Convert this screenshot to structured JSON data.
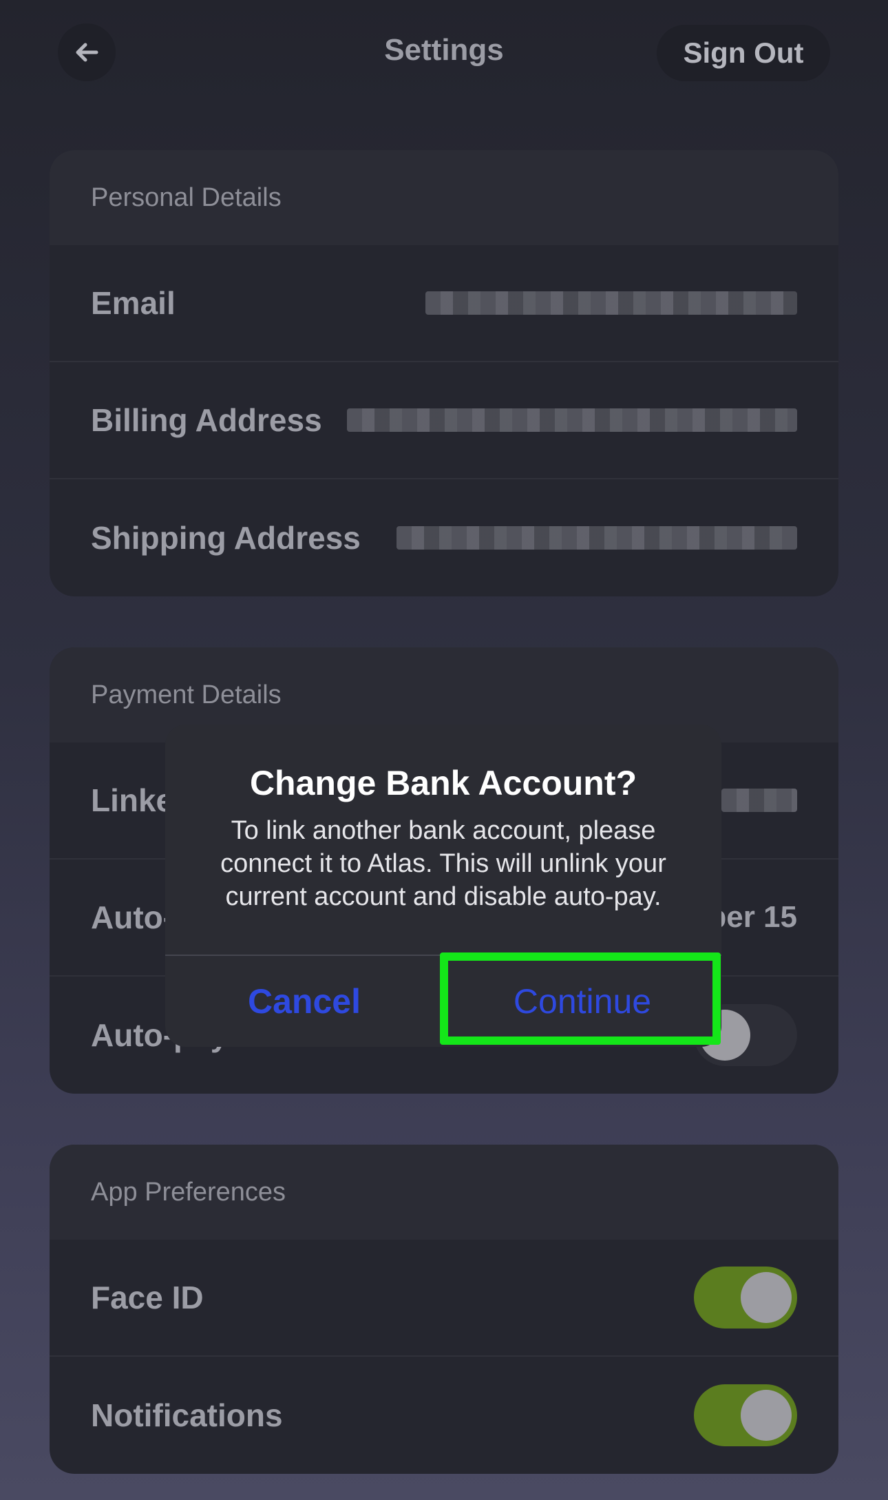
{
  "header": {
    "title": "Settings",
    "sign_out_label": "Sign Out",
    "back_icon": "arrow-left-icon"
  },
  "personal": {
    "title": "Personal Details",
    "rows": [
      {
        "label": "Email"
      },
      {
        "label": "Billing Address"
      },
      {
        "label": "Shipping Address"
      }
    ]
  },
  "payment": {
    "title": "Payment Details",
    "rows": [
      {
        "label": "Linke"
      },
      {
        "label": "Auto-",
        "value": "ber 15"
      },
      {
        "label": "Auto-pay",
        "toggle": false
      }
    ]
  },
  "app": {
    "title": "App Preferences",
    "rows": [
      {
        "label": "Face ID",
        "toggle": true
      },
      {
        "label": "Notifications",
        "toggle": true
      }
    ]
  },
  "dialog": {
    "title": "Change Bank Account?",
    "message": "To link another bank account, please connect it to Atlas. This will unlink your current account and disable auto-pay.",
    "cancel_label": "Cancel",
    "continue_label": "Continue"
  },
  "colors": {
    "toggle_on": "#5b7d1f",
    "dialog_button": "#2e49e0",
    "highlight": "#14e619"
  }
}
